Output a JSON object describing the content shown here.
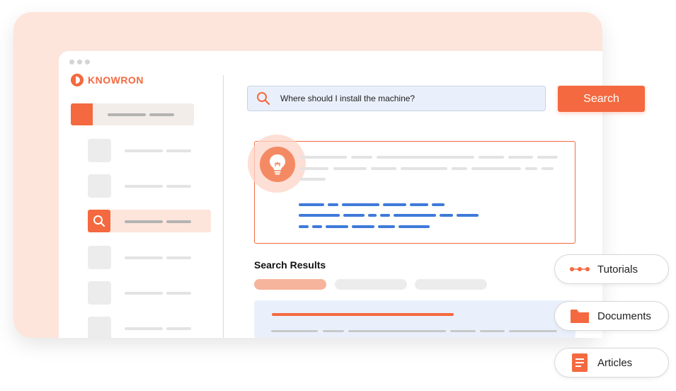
{
  "brand": {
    "name": "KNOWRON",
    "accent": "#f4693f"
  },
  "search": {
    "query": "Where should I install the machine?",
    "button_label": "Search"
  },
  "results": {
    "title": "Search Results"
  },
  "chips": [
    {
      "label": "Tutorials",
      "icon": "route-icon"
    },
    {
      "label": "Documents",
      "icon": "folder-icon"
    },
    {
      "label": "Articles",
      "icon": "document-icon"
    }
  ],
  "colors": {
    "accent": "#f4693f",
    "backdrop": "#fde5dc",
    "input_bg": "#eaf0fb",
    "link_blue": "#3f7ad8"
  }
}
